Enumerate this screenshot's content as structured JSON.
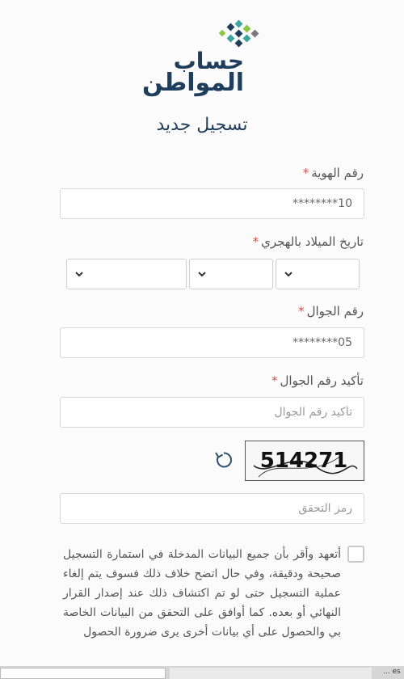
{
  "logo": {
    "line1": "حساب",
    "line2": "المواطن"
  },
  "form": {
    "title": "تسجيل جديد",
    "id_number": {
      "label": "رقم الهوية",
      "value": "10********"
    },
    "birth_date": {
      "label": "تاريخ الميلاد بالهجري"
    },
    "mobile": {
      "label": "رقم الجوال",
      "value": "05********"
    },
    "confirm_mobile": {
      "label": "تأكيد رقم الجوال",
      "placeholder": "تأكيد رقم الجوال"
    },
    "captcha": {
      "text": "514271",
      "placeholder": "رمز التحقق"
    },
    "required_mark": "*",
    "terms": "أتعهد وأقر بأن جميع البيانات المدخلة في استمارة التسجيل صحيحة ودقيقة، وفي حال اتضح خلاف ذلك فسوف يتم إلغاء عملية التسجيل حتى لو تم اكتشاف ذلك عند إصدار القرار النهائي أو بعده. كما أوافق على التحقق من البيانات الخاصة بي والحصول على أي بيانات أخرى يرى ضرورة الحصول"
  },
  "taskbar": {
    "tail_text": "... es"
  },
  "colors": {
    "brand_navy": "#1f3d5c",
    "brand_teal": "#3aa6a0",
    "required_red": "#d9534f"
  }
}
